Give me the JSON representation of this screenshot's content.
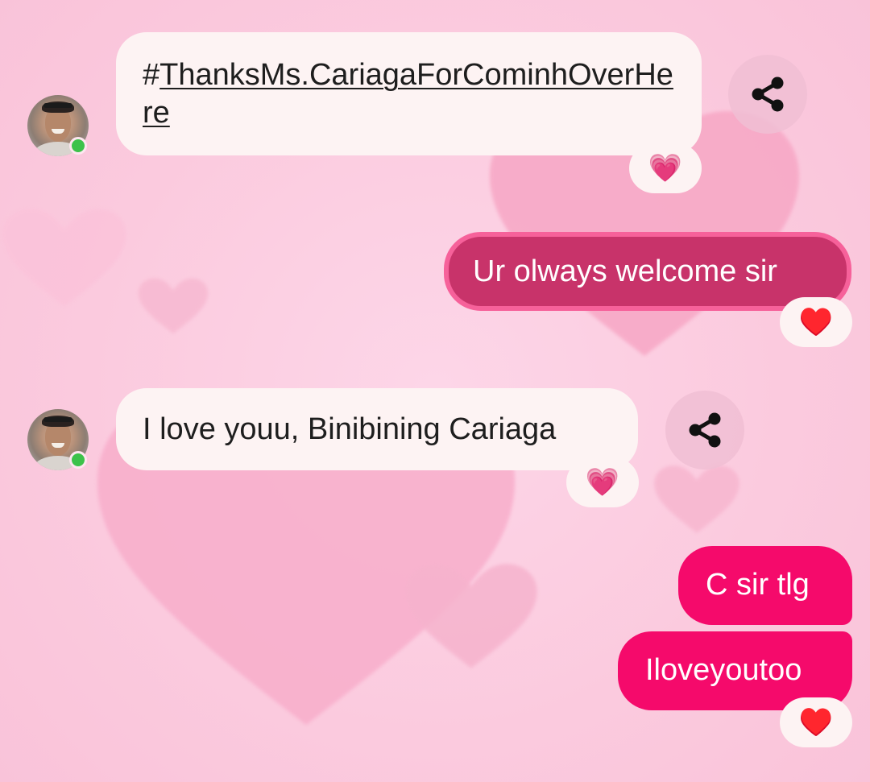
{
  "messages": [
    {
      "direction": "incoming",
      "text": "#ThanksMs.CariagaForCominhOverHere",
      "hashtag_prefix": "#",
      "link_part": "ThanksMs.CariagaForCominhOverHere",
      "reaction": "💗",
      "has_share": true
    },
    {
      "direction": "outgoing",
      "text": "Ur olways welcome sir",
      "reaction": "♥️"
    },
    {
      "direction": "incoming",
      "text": "I love youu, Binibining Cariaga",
      "reaction": "💗",
      "has_share": true
    },
    {
      "direction": "outgoing",
      "text": "C sir tlg"
    },
    {
      "direction": "outgoing",
      "text": "Iloveyoutoo",
      "reaction": "♥️"
    }
  ],
  "icons": {
    "share": "share-icon",
    "avatar": "avatar-photo",
    "online": "online-status-dot"
  },
  "colors": {
    "background": "#fccde3",
    "incoming_bubble": "#fdf3f3",
    "outgoing_bubble": "#f50a6b",
    "outgoing_bubble_highlight": "#c8336a",
    "online": "#3cc24a"
  }
}
